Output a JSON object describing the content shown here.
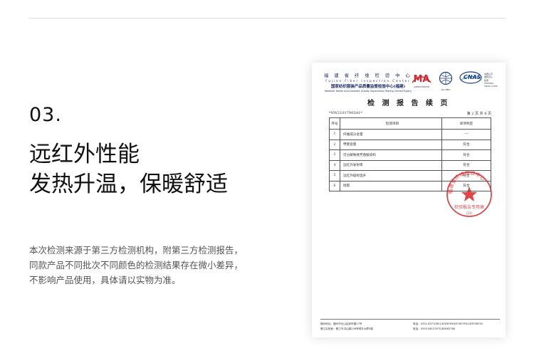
{
  "section": {
    "number": "03."
  },
  "headline": {
    "line1": "远红外性能",
    "line2": "发热升温，保暖舒适"
  },
  "description": {
    "line1": "本次检测来源于第三方检测机构，附第三方检测报告，",
    "line2": "同款产品不同批次不同颜色的检测结果存在微小差异，",
    "line3": "不影响产品使用，具体请以实物为准。"
  },
  "report": {
    "org_name": "福 建 省 纤 维 检 验 中 心",
    "org_name_en": "Fujian Fiber Inspection Center",
    "org_sub": "国家纺织服装产品质量监督检验中心(福建)",
    "org_sub_en": "National Textile And Garment Quality Supervision Testing Center(Fujian)",
    "cma_label": "MA",
    "cma_code": "220013340378",
    "ilac_caption": "ilac-MRA",
    "cnas_label": "CNAS",
    "cnas_side": [
      "中国认可",
      "国际互认",
      "检测",
      "TESTING",
      "CNAS L1949"
    ],
    "title": "检 测 报 告 续 页",
    "report_no": "NW21017005A1",
    "page_info": "第 2 页 共 8 页",
    "columns": {
      "no": "序号",
      "item": "检测项目",
      "judge": "单项判定"
    },
    "rows": [
      {
        "no": "1",
        "item": "纤维成分含量",
        "judge": "----"
      },
      {
        "no": "2",
        "item": "甲醛含量",
        "judge": "符合"
      },
      {
        "no": "3",
        "item": "可分解致癌芳香胺染料",
        "judge": "符合"
      },
      {
        "no": "4",
        "item": "远红外发射率",
        "judge": "符合"
      },
      {
        "no": "5",
        "item": "远红外辐射温升",
        "judge": "符合"
      },
      {
        "no": "6",
        "item": "纰裂",
        "judge": "符合"
      }
    ],
    "stamp_text": "检验报告专用章",
    "stamp_arc": "福建省纤维检验中心",
    "stamp_code": "(22)",
    "footer": {
      "addr1": "福州地址：福州市仓山区胪岭路17号",
      "tel1": "电话：0591-83710801/87887663/87803952/83598330",
      "addr2": "晋江实验室：晋江市洪山路236号明丰大厦3楼",
      "tel2": "电话：0595-88123970/82662768"
    }
  },
  "colors": {
    "accent_red": "#d8262a",
    "cnas_blue": "#1a3c8c",
    "text_dark": "#111111",
    "text_gray": "#555555"
  }
}
